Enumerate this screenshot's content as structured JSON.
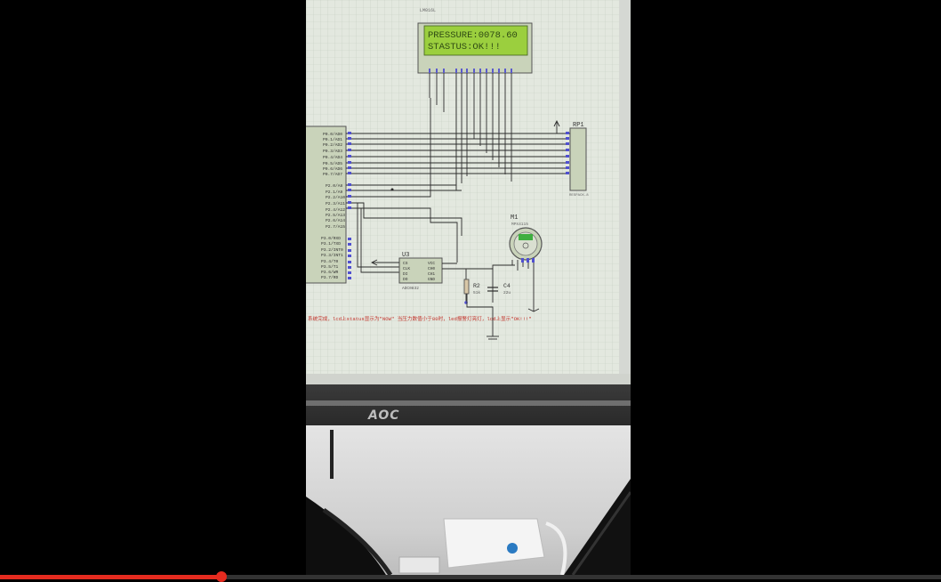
{
  "lcd": {
    "line1": "PRESSURE:0078.60",
    "line2": "STASTUS:OK!!!",
    "part": "LM016L"
  },
  "schematic": {
    "p0_pins": [
      "P0.0/AD0",
      "P0.1/AD1",
      "P0.2/AD2",
      "P0.3/AD3",
      "P0.4/AD4",
      "P0.5/AD5",
      "P0.6/AD6",
      "P0.7/AD7"
    ],
    "p2_pins": [
      "P2.0/A8",
      "P2.1/A9",
      "P2.2/A10",
      "P2.3/A11",
      "P2.4/A12",
      "P2.5/A13",
      "P2.6/A14",
      "P2.7/A15"
    ],
    "p3_pins": [
      "P3.0/RXD",
      "P3.1/TXD",
      "P3.2/INT0",
      "P3.3/INT1",
      "P3.4/T0",
      "P3.5/T1",
      "P3.6/WR",
      "P3.7/RD"
    ],
    "u3_label": "U3",
    "u3_part": "ADC0832",
    "u3_pins_left": [
      "CS",
      "CLK",
      "DI",
      "DO"
    ],
    "u3_pins_right": [
      "VCC",
      "CH0",
      "CH1",
      "GND"
    ],
    "rp1_label": "RP1",
    "rp1_part": "RESPACK-8",
    "m1_label": "M1",
    "m1_part": "MPX4115",
    "r2_label": "R2",
    "r2_value": "51k",
    "c4_label": "C4",
    "c4_value": "22u",
    "note": "系统完成，lcd上status显示为\"NOW\" 当压力数值小于80时，led报警灯亮灯，lcd上显示\"OK!!!\""
  },
  "monitor": {
    "brand": "AOC"
  },
  "player": {
    "progress_fraction": 0.235
  },
  "colors": {
    "progress": "#e52b1f",
    "lcd_bg": "#9bcf3e",
    "lcd_text": "#2f4a14",
    "chip": "#c9d3ba"
  }
}
